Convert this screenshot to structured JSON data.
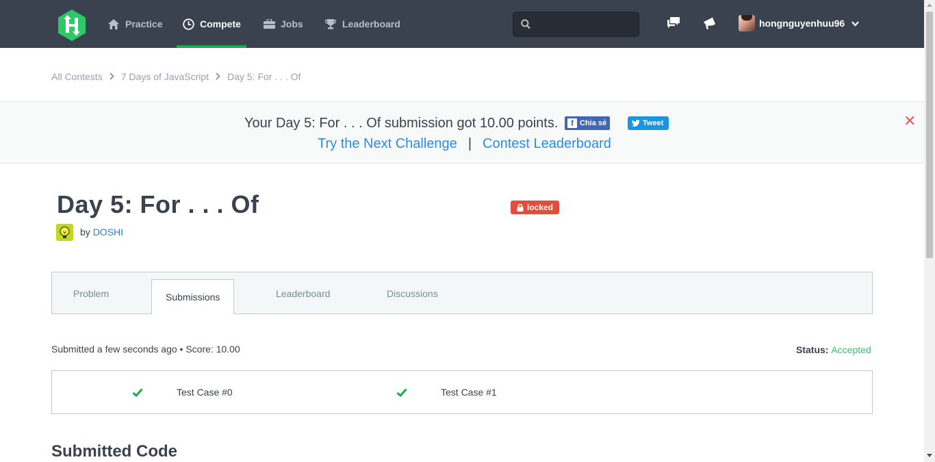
{
  "nav": {
    "items": [
      {
        "label": "Practice",
        "icon": "home-icon"
      },
      {
        "label": "Compete",
        "icon": "clock-icon"
      },
      {
        "label": "Jobs",
        "icon": "briefcase-icon"
      },
      {
        "label": "Leaderboard",
        "icon": "trophy-icon"
      }
    ],
    "active": "Compete",
    "search_placeholder": "",
    "username": "hongnguyenhuu96"
  },
  "breadcrumb": [
    "All Contests",
    "7 Days of JavaScript",
    "Day 5: For . . . Of"
  ],
  "banner": {
    "message": "Your Day 5: For . . . Of submission got 10.00 points.",
    "share_fb": "Chia sẻ",
    "share_tw": "Tweet",
    "next_link": "Try the Next Challenge",
    "divider": "|",
    "leaderboard_link": "Contest Leaderboard",
    "close": "✕"
  },
  "challenge": {
    "title": "Day 5: For . . . Of",
    "badge": "locked",
    "by": "by",
    "author": "DOSHI"
  },
  "tabs": [
    "Problem",
    "Submissions",
    "Leaderboard",
    "Discussions"
  ],
  "active_tab": "Submissions",
  "submission": {
    "summary": "Submitted a few seconds ago • Score: 10.00",
    "status_label": "Status:",
    "status_value": "Accepted"
  },
  "test_cases": [
    "Test Case #0",
    "Test Case #1"
  ],
  "section_title": "Submitted Code",
  "colors": {
    "nav_bg": "#39424e",
    "accent_green": "#1ba94c",
    "link_blue": "#1a82e2",
    "locked_red": "#e34d3b",
    "accepted_green": "#2ec866"
  }
}
